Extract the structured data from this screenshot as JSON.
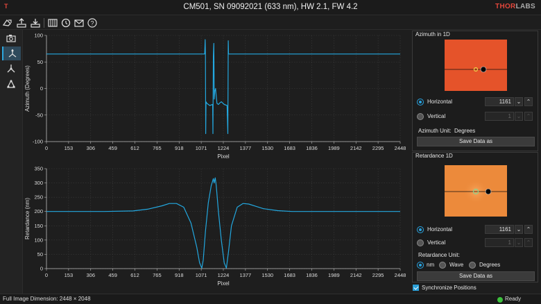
{
  "window": {
    "title": "CM501, SN 09092021 (633 nm), HW 2.1, FW 4.2",
    "brand_red": "THOR",
    "brand_gray": "LABS",
    "app_icon": "T"
  },
  "toolbar": {
    "icons": [
      "load-icon",
      "export-icon",
      "import-icon",
      "grid-icon",
      "reset-icon",
      "mail-icon",
      "help-icon"
    ]
  },
  "nav": {
    "items": [
      "camera-icon",
      "azimuth-plot-icon",
      "retardance-plot-icon",
      "combined-plot-icon"
    ],
    "active_index": 1
  },
  "azimuth_panel": {
    "title": "Azimuth in 1D",
    "horizontal_label": "Horizontal",
    "horizontal_value": "1161",
    "vertical_label": "Vertical",
    "vertical_value": "1",
    "unit_label": "Azimuth Unit:",
    "unit_value": "Degrees",
    "save_label": "Save Data as",
    "thumb_color": "#e5532a"
  },
  "retardance_panel": {
    "title": "Retardance 1D",
    "horizontal_label": "Horizontal",
    "horizontal_value": "1161",
    "vertical_label": "Vertical",
    "vertical_value": "1",
    "unit_label": "Retardance Unit:",
    "unit_options": [
      "nm",
      "Wave",
      "Degrees"
    ],
    "unit_selected": "nm",
    "save_label": "Save Data as",
    "thumb_color": "#ec8a3b"
  },
  "sync": {
    "label": "Synchronize Positions",
    "checked": true
  },
  "status": {
    "left": "Full Image Dimension: 2448 × 2048",
    "right": "Ready"
  },
  "chart_data": [
    {
      "type": "line",
      "title": "",
      "xlabel": "Pixel",
      "ylabel": "Azimuth (Degrees)",
      "xlim": [
        0,
        2448
      ],
      "ylim": [
        -100,
        100
      ],
      "xticks": [
        0,
        153,
        306,
        459,
        612,
        765,
        918,
        1071,
        1224,
        1377,
        1530,
        1683,
        1836,
        1989,
        2142,
        2295,
        2448
      ],
      "yticks": [
        -100,
        -50,
        0,
        50,
        100
      ],
      "color": "#23a8e0",
      "x": [
        0,
        300,
        600,
        900,
        1050,
        1095,
        1098,
        1100,
        1102,
        1104,
        1110,
        1130,
        1150,
        1152,
        1155,
        1158,
        1161,
        1165,
        1170,
        1175,
        1180,
        1190,
        1200,
        1210,
        1230,
        1250,
        1255,
        1258,
        1260,
        1262,
        1265,
        1280,
        1400,
        1600,
        1800,
        2000,
        2200,
        2448
      ],
      "y": [
        65,
        65,
        65,
        65,
        65,
        65,
        92,
        65,
        -85,
        -25,
        -28,
        -32,
        -30,
        -85,
        60,
        85,
        -20,
        -5,
        0,
        -15,
        -28,
        -30,
        -27,
        -25,
        -30,
        -32,
        -85,
        90,
        65,
        65,
        65,
        65,
        65,
        65,
        65,
        65,
        65,
        65
      ]
    },
    {
      "type": "line",
      "title": "",
      "xlabel": "Pixel",
      "ylabel": "Retardance (nm)",
      "xlim": [
        0,
        2448
      ],
      "ylim": [
        0,
        350
      ],
      "xticks": [
        0,
        153,
        306,
        459,
        612,
        765,
        918,
        1071,
        1224,
        1377,
        1530,
        1683,
        1836,
        1989,
        2142,
        2295,
        2448
      ],
      "yticks": [
        0,
        50,
        100,
        150,
        200,
        250,
        300,
        350
      ],
      "color": "#23a8e0",
      "x": [
        0,
        200,
        400,
        600,
        700,
        800,
        850,
        900,
        950,
        1000,
        1040,
        1060,
        1075,
        1085,
        1100,
        1120,
        1140,
        1155,
        1160,
        1168,
        1175,
        1190,
        1210,
        1230,
        1245,
        1260,
        1280,
        1320,
        1360,
        1400,
        1450,
        1500,
        1600,
        1700,
        1800,
        2000,
        2200,
        2448
      ],
      "y": [
        200,
        200,
        200,
        202,
        208,
        220,
        228,
        228,
        215,
        160,
        75,
        20,
        2,
        30,
        130,
        230,
        290,
        315,
        300,
        318,
        290,
        200,
        100,
        20,
        2,
        60,
        150,
        215,
        228,
        226,
        218,
        210,
        203,
        200,
        200,
        200,
        200,
        200
      ]
    }
  ]
}
